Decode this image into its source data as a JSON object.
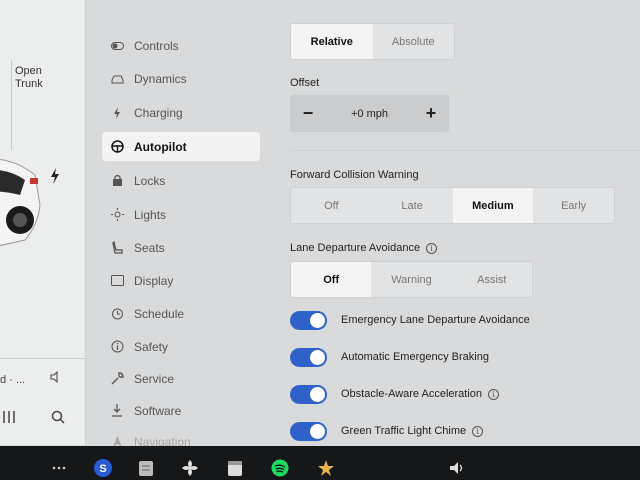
{
  "car_panel": {
    "trunk_line1": "Open",
    "trunk_line2": "Trunk",
    "bottom_text": "d · ..."
  },
  "nav": {
    "items": [
      {
        "label": "Controls",
        "icon": "toggle-icon"
      },
      {
        "label": "Dynamics",
        "icon": "car-icon"
      },
      {
        "label": "Charging",
        "icon": "bolt-icon"
      },
      {
        "label": "Autopilot",
        "icon": "steering-wheel-icon",
        "active": true
      },
      {
        "label": "Locks",
        "icon": "lock-icon"
      },
      {
        "label": "Lights",
        "icon": "sun-icon"
      },
      {
        "label": "Seats",
        "icon": "seat-icon"
      },
      {
        "label": "Display",
        "icon": "display-icon"
      },
      {
        "label": "Schedule",
        "icon": "alarm-icon"
      },
      {
        "label": "Safety",
        "icon": "info-icon"
      },
      {
        "label": "Service",
        "icon": "wrench-icon"
      },
      {
        "label": "Software",
        "icon": "download-icon"
      },
      {
        "label": "Navigation",
        "icon": "navigation-icon"
      }
    ]
  },
  "speed_mode": {
    "options": [
      "Relative",
      "Absolute"
    ],
    "selected": "Relative"
  },
  "offset": {
    "label": "Offset",
    "value": "+0 mph",
    "minus": "−",
    "plus": "+"
  },
  "fcw": {
    "label": "Forward Collision Warning",
    "options": [
      "Off",
      "Late",
      "Medium",
      "Early"
    ],
    "selected": "Medium"
  },
  "lda": {
    "label": "Lane Departure Avoidance",
    "options": [
      "Off",
      "Warning",
      "Assist"
    ],
    "selected": "Off"
  },
  "toggles": [
    {
      "label": "Emergency Lane Departure Avoidance",
      "on": true,
      "info": false
    },
    {
      "label": "Automatic Emergency Braking",
      "on": true,
      "info": false
    },
    {
      "label": "Obstacle-Aware Acceleration",
      "on": true,
      "info": true
    },
    {
      "label": "Green Traffic Light Chime",
      "on": true,
      "info": true
    }
  ],
  "colors": {
    "toggle_on": "#2f62c8",
    "background": "#d9dadb",
    "taskbar": "#161718"
  }
}
